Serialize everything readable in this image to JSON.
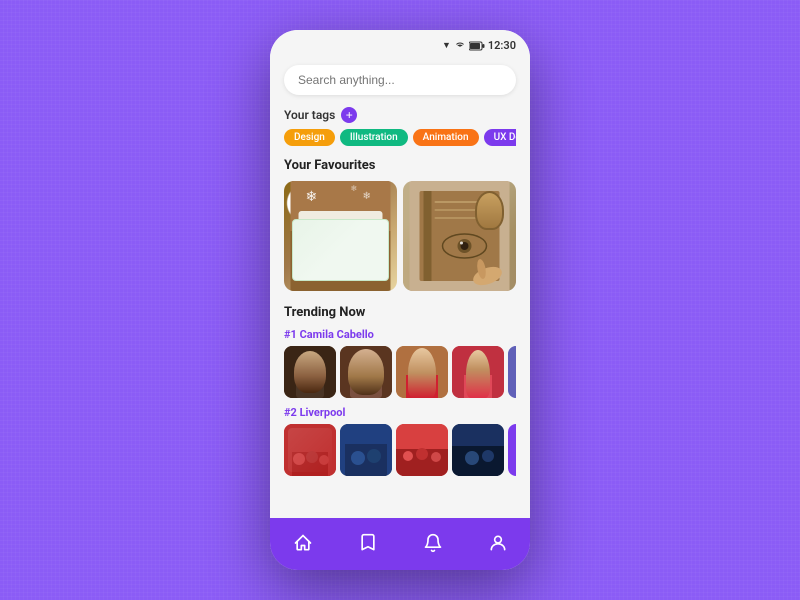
{
  "background": {
    "color": "#8B5CF6"
  },
  "statusBar": {
    "time": "12:30"
  },
  "search": {
    "placeholder": "Search anything..."
  },
  "tags": {
    "sectionTitle": "Your tags",
    "addLabel": "+",
    "items": [
      {
        "label": "Design",
        "colorClass": "tag-design"
      },
      {
        "label": "Illustration",
        "colorClass": "tag-illustration"
      },
      {
        "label": "Animation",
        "colorClass": "tag-animation"
      },
      {
        "label": "UX Des",
        "colorClass": "tag-uxdes"
      }
    ]
  },
  "favourites": {
    "sectionTitle": "Your Favourites"
  },
  "trending": {
    "sectionTitle": "Trending Now",
    "items": [
      {
        "rank": "#1",
        "name": "Camila Cabello"
      },
      {
        "rank": "#2",
        "name": "Liverpool"
      }
    ]
  },
  "bottomNav": {
    "items": [
      {
        "name": "home",
        "label": "Home",
        "active": true
      },
      {
        "name": "bookmark",
        "label": "Bookmark",
        "active": false
      },
      {
        "name": "notification",
        "label": "Notification",
        "active": false
      },
      {
        "name": "profile",
        "label": "Profile",
        "active": false
      }
    ]
  },
  "accentColor": "#7C3AED"
}
